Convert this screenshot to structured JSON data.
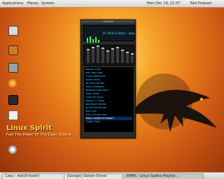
{
  "topbar": {
    "apps": "Applications",
    "places": "Places",
    "system": "System",
    "clock": "Mon Dec 19, 21:57",
    "user": "Bali Prakash"
  },
  "desktop_icons": [
    {
      "name": "computer-icon",
      "label": ""
    },
    {
      "name": "home-icon",
      "label": ""
    },
    {
      "name": "trash-icon",
      "label": ""
    },
    {
      "name": "firefox-icon",
      "label": ""
    },
    {
      "name": "terminal-icon",
      "label": ""
    },
    {
      "name": "document-icon",
      "label": ""
    },
    {
      "name": "disc-icon",
      "label": ""
    }
  ],
  "branding": {
    "title": "Linux Spirit",
    "tagline": "Feel The Power Of The Open Source"
  },
  "winamp": {
    "title": "WINAMP",
    "now_playing": "10. Rizal Zulkarn - lagu...",
    "playlist": [
      "Mayak Chitu",
      "Jaan Jaan Jaan",
      "Chala Bahanwa",
      "Salah Salah",
      "Jab Har Kisi Bhi",
      "Yaara Dildaara",
      "Kasamunnad Bhai",
      "Tohar Tohar",
      "Chali Dil Sajan",
      "Maula 1.0 Zara",
      "Aaa Kaali Kholdi",
      "Kuchh Bhi Bhaile",
      "Tere Liye",
      "Tuje Chhupa Hain",
      "Gaya Langkhali Nagari",
      "Chale Chale"
    ],
    "selected_index": 14
  },
  "taskbar": {
    "items": [
      {
        "label": "Lexu - Ask(Ill-hoelr)",
        "active": false
      },
      {
        "label": "[Google] Sistem Exmd",
        "active": false
      },
      {
        "label": "XMMS - Linux Sadha Playlist...",
        "active": true
      }
    ]
  },
  "colors": {
    "desktop_top": "#ffd77a",
    "desktop_bottom": "#8e300a",
    "panel": "#e7e3dd",
    "winamp_text": "#3ec7ff"
  }
}
